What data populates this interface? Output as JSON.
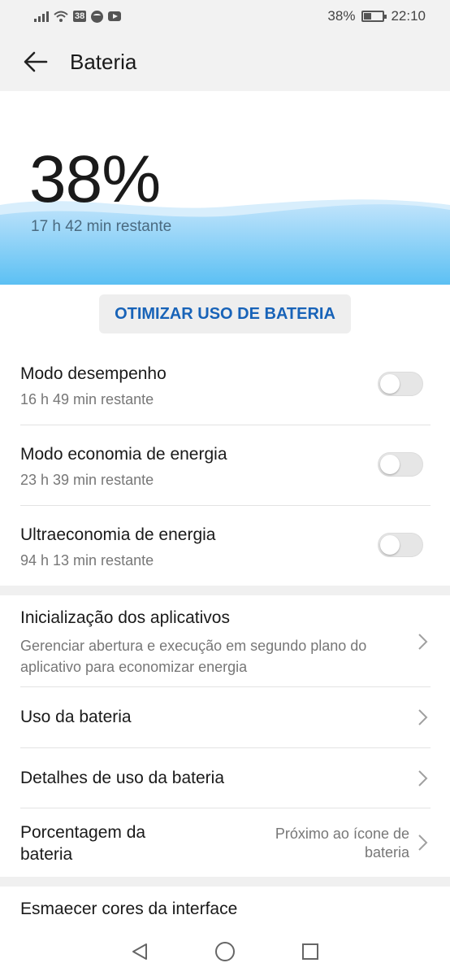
{
  "status_bar": {
    "notification_badge": "38",
    "battery_percent": "38%",
    "time": "22:10",
    "icons": [
      "signal-icon",
      "wifi-icon",
      "badge-icon",
      "spotify-icon",
      "youtube-icon",
      "battery-icon"
    ]
  },
  "header": {
    "title": "Bateria",
    "back_icon": "arrow-left-icon"
  },
  "hero": {
    "percent": "38%",
    "remaining": "17 h 42 min restante",
    "level": 0.38
  },
  "optimize_button": "OTIMIZAR USO DE BATERIA",
  "modes": [
    {
      "title": "Modo desempenho",
      "subtitle": "16 h 49 min restante",
      "enabled": false
    },
    {
      "title": "Modo economia de energia",
      "subtitle": "23 h 39 min restante",
      "enabled": false
    },
    {
      "title": "Ultraeconomia de energia",
      "subtitle": "94 h 13 min restante",
      "enabled": false
    }
  ],
  "settings": {
    "app_launch": {
      "title": "Inicialização dos aplicativos",
      "subtitle_line1": "Gerenciar abertura e execução em segundo plano do",
      "subtitle_line2": "aplicativo para economizar energia"
    },
    "battery_usage": {
      "title": "Uso da bateria"
    },
    "battery_usage_details": {
      "title": "Detalhes de uso da bateria"
    },
    "battery_percentage": {
      "title_line1": "Porcentagem da",
      "title_line2": "bateria",
      "value_line1": "Próximo ao ícone de",
      "value_line2": "bateria"
    },
    "fade_colors": {
      "title": "Esmaecer cores da interface"
    }
  },
  "colors": {
    "accent": "#1863b8",
    "wave_light": "#bfe3fb",
    "wave_deep": "#5cc0f3",
    "background_band": "#f0f0f0"
  },
  "nav_bar": {
    "back": "triangle-back-icon",
    "home": "circle-home-icon",
    "recents": "square-recents-icon"
  }
}
